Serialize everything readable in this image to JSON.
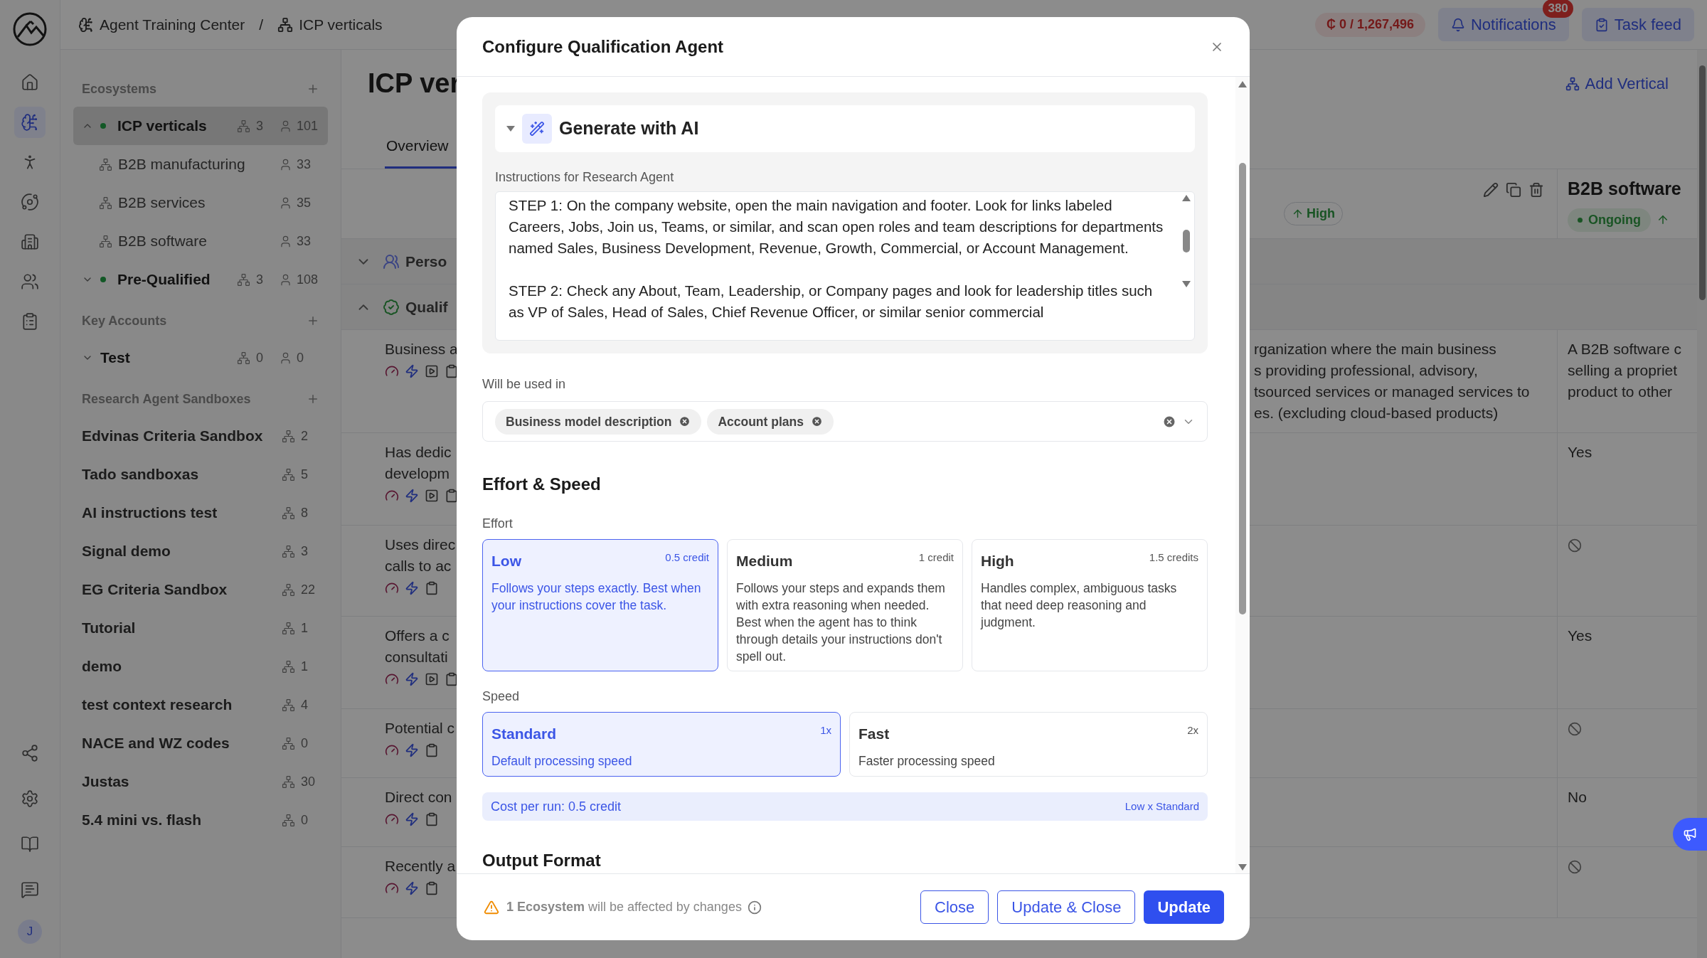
{
  "rail": {
    "items": [
      {
        "kind": "home",
        "selected": false
      },
      {
        "kind": "brain",
        "selected": true
      },
      {
        "kind": "people",
        "selected": false
      },
      {
        "kind": "orbit",
        "selected": false
      },
      {
        "kind": "building",
        "selected": false
      },
      {
        "kind": "users",
        "selected": false
      },
      {
        "kind": "clipboard",
        "selected": false
      }
    ],
    "bottom": [
      {
        "kind": "graph"
      },
      {
        "kind": "settings"
      },
      {
        "kind": "book"
      },
      {
        "kind": "chat"
      }
    ],
    "avatar": "J"
  },
  "breadcrumb": {
    "items": [
      "Agent Training Center",
      "ICP verticals"
    ],
    "separator": "/"
  },
  "header": {
    "credits": "₵ 0 / 1,267,496",
    "notifications": {
      "label": "Notifications",
      "badge": "380"
    },
    "task_feed": "Task feed"
  },
  "sidebar": {
    "sections": [
      {
        "title": "Ecosystems",
        "items": [
          {
            "label": "ICP verticals",
            "expanded": true,
            "selected": true,
            "dot": true,
            "groups": "3",
            "people": "101",
            "children": [
              {
                "label": "B2B manufacturing",
                "people": "33"
              },
              {
                "label": "B2B services",
                "people": "35"
              },
              {
                "label": "B2B software",
                "people": "33"
              }
            ]
          },
          {
            "label": "Pre-Qualified",
            "expanded": false,
            "selected": false,
            "dot": true,
            "groups": "3",
            "people": "108"
          }
        ]
      },
      {
        "title": "Key Accounts",
        "items": [
          {
            "label": "Test",
            "expanded": false,
            "selected": false,
            "dot": false,
            "groups": "0",
            "people": "0"
          }
        ]
      },
      {
        "title": "Research Agent Sandboxes",
        "items": [
          {
            "label": "Edvinas Criteria Sandbox",
            "selected": false,
            "groups": "2"
          },
          {
            "label": "Tado sandboxas",
            "selected": false,
            "groups": "5"
          },
          {
            "label": "AI instructions test",
            "selected": false,
            "groups": "8"
          },
          {
            "label": "Signal demo",
            "selected": false,
            "groups": "3"
          },
          {
            "label": "EG Criteria Sandbox",
            "selected": false,
            "groups": "22"
          },
          {
            "label": "Tutorial",
            "selected": false,
            "groups": "1"
          },
          {
            "label": "demo",
            "selected": false,
            "groups": "1"
          },
          {
            "label": "test context research",
            "selected": false,
            "groups": "4"
          },
          {
            "label": "NACE and WZ codes",
            "selected": false,
            "groups": "0"
          },
          {
            "label": "Justas",
            "selected": false,
            "groups": "30"
          },
          {
            "label": "5.4 mini vs. flash",
            "selected": false,
            "groups": "0"
          }
        ]
      }
    ]
  },
  "page": {
    "title": "ICP ver",
    "tabs": [
      {
        "label": "Overview",
        "selected": true
      }
    ],
    "add_button": "Add Vertical"
  },
  "table": {
    "columns": [
      {
        "kind": "actions",
        "chip": "High"
      },
      {
        "kind": "title",
        "title": "B2B software",
        "status": "Ongoing"
      }
    ],
    "groups": [
      {
        "label": "Perso",
        "expanded": false
      },
      {
        "label": "Qualif",
        "expanded": true
      }
    ],
    "rows": [
      {
        "label": [
          "Business a"
        ],
        "kind": "with_preview",
        "cells": [
          {
            "kind": "text",
            "lines": [
              "rganization where the main business",
              "s providing professional, advisory,",
              "tsourced services or managed services to",
              "es. (excluding cloud-based products)"
            ]
          },
          {
            "kind": "text",
            "lines": [
              "A B2B software c",
              "selling a propriet",
              "product to other"
            ]
          }
        ]
      },
      {
        "label": [
          "Has dedic",
          "developm"
        ],
        "kind": "with_preview",
        "cells": [
          {
            "kind": "empty"
          },
          {
            "kind": "text",
            "lines": [
              "Yes"
            ]
          }
        ]
      },
      {
        "label": [
          "Uses direc",
          "calls to ac"
        ],
        "kind": "plain",
        "cells": [
          {
            "kind": "empty"
          },
          {
            "kind": "none"
          }
        ]
      },
      {
        "label": [
          "Offers a c",
          "consultati"
        ],
        "kind": "with_preview",
        "cells": [
          {
            "kind": "empty"
          },
          {
            "kind": "text",
            "lines": [
              "Yes"
            ]
          }
        ]
      },
      {
        "label": [
          "Potential c"
        ],
        "kind": "plain",
        "cells": [
          {
            "kind": "empty"
          },
          {
            "kind": "none"
          }
        ]
      },
      {
        "label": [
          "Direct con"
        ],
        "kind": "plain",
        "cells": [
          {
            "kind": "empty"
          },
          {
            "kind": "text",
            "lines": [
              "No"
            ]
          }
        ]
      },
      {
        "label": [
          "Recently a"
        ],
        "kind": "plain",
        "cells": [
          {
            "kind": "empty"
          },
          {
            "kind": "none"
          }
        ]
      }
    ]
  },
  "modal": {
    "title": "Configure Qualification Agent",
    "generate": {
      "label": "Generate with AI",
      "expanded": true
    },
    "instructions": {
      "label": "Instructions for Research Agent",
      "value": "STEP 1: On the company website, open the main navigation and footer. Look for links labeled Careers, Jobs, Join us, Teams, or similar, and scan open roles and team descriptions for departments named Sales, Business Development, Revenue, Growth, Commercial, or Account Management.\n\nSTEP 2: Check any About, Team, Leadership, or Company pages and look for leadership titles such as VP of Sales, Head of Sales, Chief Revenue Officer, or similar senior commercial"
    },
    "used_in": {
      "label": "Will be used in",
      "chips": [
        "Business model description",
        "Account plans"
      ]
    },
    "effort_speed_title": "Effort & Speed",
    "effort": {
      "label": "Effort",
      "options": [
        {
          "title": "Low",
          "cost": "0.5 credit",
          "description": "Follows your steps exactly. Best when your instructions cover the task.",
          "selected": true
        },
        {
          "title": "Medium",
          "cost": "1 credit",
          "description": "Follows your steps and expands them with extra reasoning when needed. Best when the agent has to think through details your instructions don't spell out.",
          "selected": false
        },
        {
          "title": "High",
          "cost": "1.5 credits",
          "description": "Handles complex, ambiguous tasks that need deep reasoning and judgment.",
          "selected": false
        }
      ]
    },
    "speed": {
      "label": "Speed",
      "options": [
        {
          "title": "Standard",
          "cost": "1x",
          "description": "Default processing speed",
          "selected": true
        },
        {
          "title": "Fast",
          "cost": "2x",
          "description": "Faster processing speed",
          "selected": false
        }
      ]
    },
    "cost": {
      "text": "Cost per run: 0.5 credit",
      "formula": "Low x Standard"
    },
    "output_title": "Output Format",
    "footer": {
      "warning": "**1 Ecosystem** will be affected by changes",
      "buttons": [
        {
          "label": "Close",
          "kind": "outline"
        },
        {
          "label": "Update & Close",
          "kind": "outline"
        },
        {
          "label": "Update",
          "kind": "primary"
        }
      ]
    }
  }
}
